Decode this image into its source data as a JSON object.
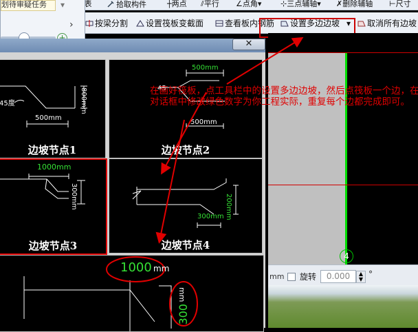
{
  "toolbar1": {
    "task_text": "划待审疑任务",
    "list": "列表",
    "pick_component": "拾取构件",
    "two_points": "两点",
    "parallel": "平行",
    "point_angle": "点角",
    "three_point_aux": "三点辅轴",
    "delete_aux": "删除辅轴",
    "dimension": "尺寸"
  },
  "toolbar2": {
    "split_by_beam": "按梁分割",
    "set_raft_section": "设置筏板变截面",
    "view_rebar_in_slab": "查看板内钢筋",
    "set_multi_slope": "设置多边边坡",
    "cancel_all_slopes": "取消所有边坡"
  },
  "dialog": {
    "close_glyph": "✕",
    "nodes": [
      {
        "label": "边坡节点1",
        "dims": [
          "800mm",
          "45度",
          "500mm"
        ]
      },
      {
        "label": "边坡节点2",
        "dims": [
          "500mm",
          "45",
          "500mm"
        ]
      },
      {
        "label": "边坡节点3",
        "dims": [
          "1000mm",
          "300mm"
        ]
      },
      {
        "label": "边坡节点4",
        "dims": [
          "200mm",
          "300mm"
        ]
      }
    ],
    "preview": {
      "width_value": "1000",
      "width_unit": "mm",
      "height_value": "300",
      "height_unit": "mm"
    }
  },
  "canvas": {
    "axis_label": "4"
  },
  "statusbar": {
    "unit": "mm",
    "rotate_label": "旋转",
    "rotate_value": "0.000",
    "degree": "°"
  },
  "annotation": {
    "text": "在画好筏板，点工具栏中的设置多边边坡，然后点筏板一个边，在对话框中修改绿色数字为你工程实际，重复每个边都完成即可。"
  },
  "colors": {
    "accent_red": "#e00000",
    "dim_green": "#35e035",
    "highlight": "#cc0000"
  }
}
